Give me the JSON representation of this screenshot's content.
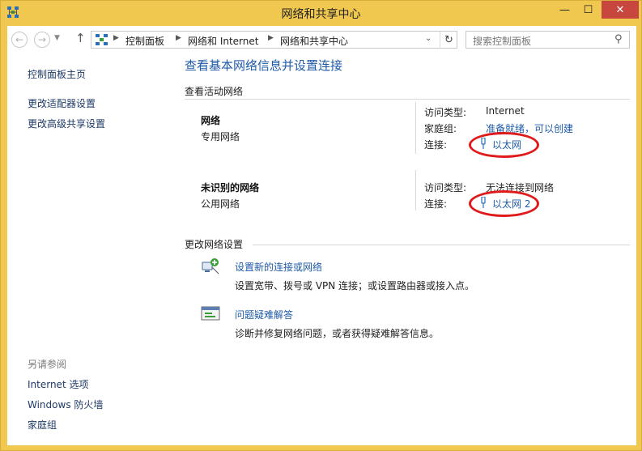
{
  "window": {
    "title": "网络和共享中心",
    "min_label": "—",
    "max_label": "☐",
    "close_label": "✕"
  },
  "navbar": {
    "back_glyph": "←",
    "forward_glyph": "→",
    "up_glyph": "↑",
    "breadcrumb": [
      "控制面板",
      "网络和 Internet",
      "网络和共享中心"
    ],
    "search_placeholder": "搜索控制面板"
  },
  "sidebar": {
    "items": [
      "控制面板主页",
      "更改适配器设置",
      "更改高级共享设置"
    ],
    "see_also_heading": "另请参阅",
    "see_also": [
      "Internet 选项",
      "Windows 防火墙",
      "家庭组"
    ]
  },
  "main": {
    "title": "查看基本网络信息并设置连接",
    "active_heading": "查看活动网络",
    "networks": [
      {
        "name": "网络",
        "type": "专用网络",
        "access_label": "访问类型:",
        "access_value": "Internet",
        "homegroup_label": "家庭组:",
        "homegroup_value": "准备就绪，可以创建",
        "connection_label": "连接:",
        "connection_value": "以太网"
      },
      {
        "name": "未识别的网络",
        "type": "公用网络",
        "access_label": "访问类型:",
        "access_value": "无法连接到网络",
        "connection_label": "连接:",
        "connection_value": "以太网 2"
      }
    ],
    "change_heading": "更改网络设置",
    "tasks": [
      {
        "link": "设置新的连接或网络",
        "desc": "设置宽带、拨号或 VPN 连接；或设置路由器或接入点。",
        "icon": "new-connection-icon"
      },
      {
        "link": "问题疑难解答",
        "desc": "诊断并修复网络问题，或者获得疑难解答信息。",
        "icon": "troubleshoot-icon"
      }
    ]
  },
  "colors": {
    "frame": "#f0c850",
    "link": "#1e5aa8",
    "annotation": "#e01a1a"
  }
}
